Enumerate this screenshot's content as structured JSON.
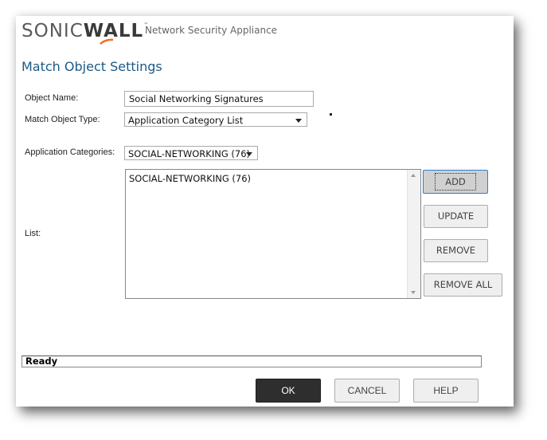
{
  "header": {
    "logo_part1": "SONIC",
    "logo_part2": "WALL",
    "logo_tm": "™",
    "product_name": "Network Security Appliance",
    "brand_colors": {
      "logo_gray": "#5a5a5a",
      "logo_accent": "#f26b21",
      "title_blue": "#1a5a86"
    }
  },
  "page_title": "Match Object Settings",
  "form": {
    "object_name": {
      "label": "Object Name:",
      "value": "Social Networking Signatures"
    },
    "match_object_type": {
      "label": "Match Object Type:",
      "selected": "Application Category List"
    },
    "application_categories": {
      "label": "Application Categories:",
      "selected": "SOCIAL-NETWORKING (76)"
    },
    "list": {
      "label": "List:",
      "items": [
        "SOCIAL-NETWORKING (76)"
      ]
    }
  },
  "list_buttons": {
    "add": "ADD",
    "update": "UPDATE",
    "remove": "REMOVE",
    "remove_all": "REMOVE ALL"
  },
  "status": "Ready",
  "footer_buttons": {
    "ok": "OK",
    "cancel": "CANCEL",
    "help": "HELP"
  }
}
